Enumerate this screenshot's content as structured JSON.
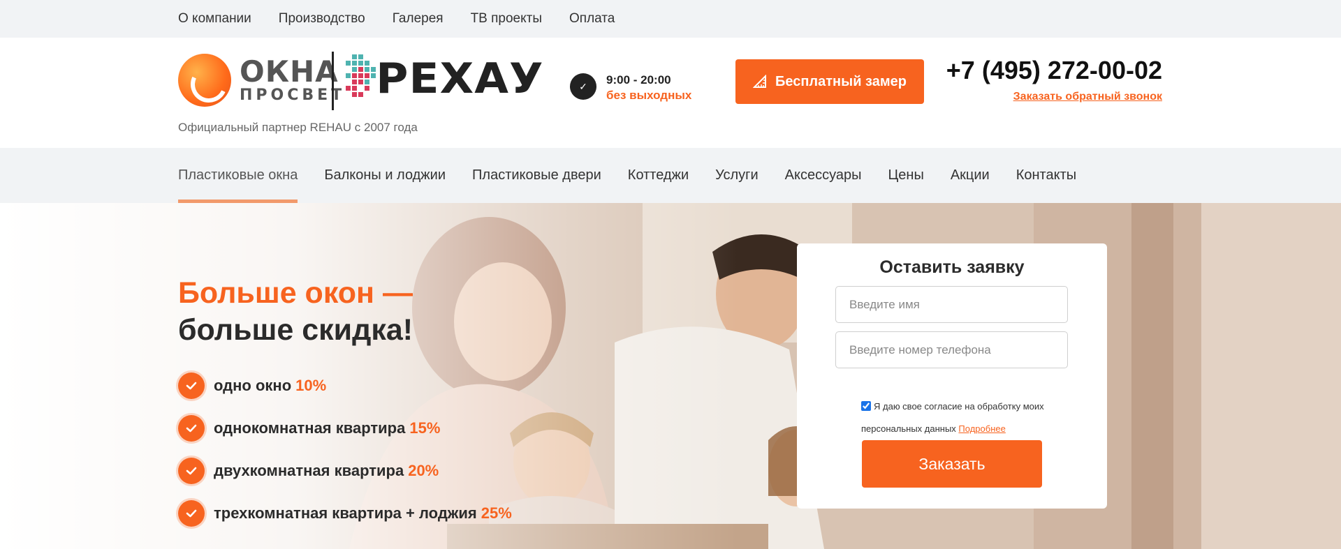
{
  "topbar": {
    "items": [
      {
        "label": "О компании"
      },
      {
        "label": "Производство"
      },
      {
        "label": "Галерея"
      },
      {
        "label": "ТВ проекты"
      },
      {
        "label": "Оплата"
      }
    ]
  },
  "header": {
    "logo_word1": "ОКНА",
    "logo_word2": "ПРОСВЕТ",
    "rehau_logo": "РЕХАУ",
    "partner_text": "Официальный партнер REHAU с 2007 года",
    "hours": "9:00 - 20:00",
    "days": "без выходных",
    "measure_button": "Бесплатный замер",
    "phone": "+7 (495) 272-00-02",
    "callback_link": "Заказать обратный звонок"
  },
  "mainnav": {
    "items": [
      {
        "label": "Пластиковые окна",
        "active": true
      },
      {
        "label": "Балконы и лоджии"
      },
      {
        "label": "Пластиковые двери"
      },
      {
        "label": "Коттеджи"
      },
      {
        "label": "Услуги"
      },
      {
        "label": "Аксессуары"
      },
      {
        "label": "Цены"
      },
      {
        "label": "Акции"
      },
      {
        "label": "Контакты"
      }
    ]
  },
  "hero": {
    "title_line1": "Больше окон —",
    "title_line2": "больше скидка!",
    "benefits": [
      {
        "text": "одно окно",
        "discount": "10%"
      },
      {
        "text": "однокомнатная квартира",
        "discount": "15%"
      },
      {
        "text": "двухкомнатная квартира",
        "discount": "20%"
      },
      {
        "text": "трехкомнатная квартира + лоджия",
        "discount": "25%"
      }
    ]
  },
  "form": {
    "title": "Оставить заявку",
    "name_placeholder": "Введите имя",
    "phone_placeholder": "Введите номер телефона",
    "consent_text": "Я даю свое согласие на обработку моих персональных данных",
    "consent_link": "Подробнее",
    "consent_checked": true,
    "submit_label": "Заказать"
  },
  "colors": {
    "accent": "#f7631f",
    "nav_bg": "#f1f3f5",
    "text_dark": "#2b2b2b"
  }
}
